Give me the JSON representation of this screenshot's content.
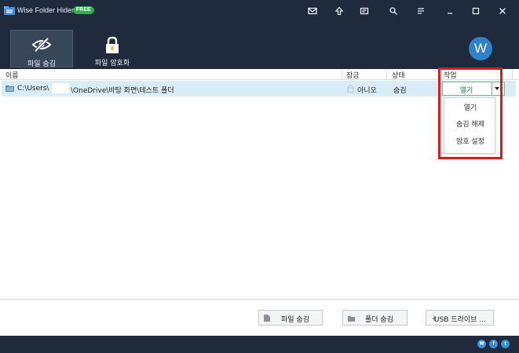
{
  "titlebar": {
    "title": "Wise Folder Hider",
    "badge": "FREE",
    "icons": [
      "mail-icon",
      "upgrade-icon",
      "feedback-icon",
      "settings-icon",
      "menu-icon",
      "minimize-icon",
      "maximize-icon",
      "close-icon"
    ]
  },
  "toolbar": {
    "hide_file": "파일 숨김",
    "encrypt_file": "파일 암호화",
    "avatar_letter": "W"
  },
  "columns": {
    "name": "이름",
    "lock": "잠금",
    "state": "상태",
    "action": "작업"
  },
  "rows": [
    {
      "path_prefix": "C:\\Users\\",
      "path_suffix": "\\OneDrive\\바탕 화면\\테스트 폴더",
      "lock": "아니오",
      "state": "숨김",
      "action": "열기"
    }
  ],
  "action_menu": [
    "열기",
    "숨김 해제",
    "암호 설정"
  ],
  "bottom_buttons": {
    "hide_file": "파일 숨김",
    "hide_folder": "폴더 숨김",
    "usb": "USB 드라이브 ..."
  },
  "social": [
    "mail-icon",
    "facebook-icon",
    "twitter-icon"
  ],
  "colors": {
    "bar": "#1f2b3c",
    "row_selected": "#d8edf7",
    "highlight": "#e0191e",
    "badge": "#29b34a",
    "action_text": "#1b7a3e"
  }
}
